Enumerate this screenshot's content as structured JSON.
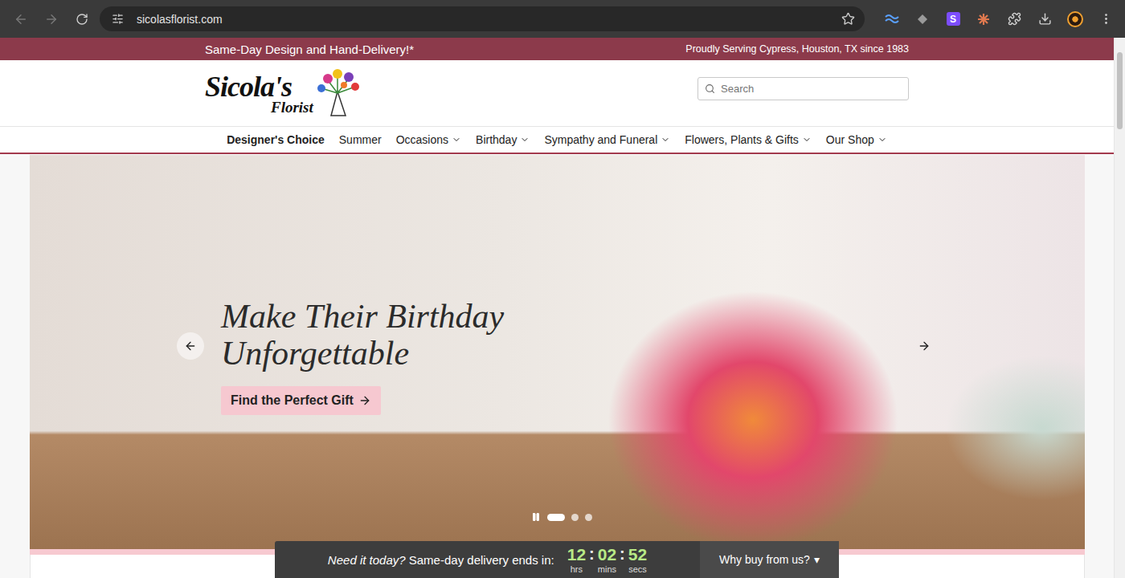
{
  "browser": {
    "url": "sicolasflorist.com",
    "extension_badge": "S"
  },
  "promo_bar": {
    "left": "Same-Day Design and Hand-Delivery!*",
    "right": "Proudly Serving Cypress, Houston, TX since 1983"
  },
  "logo": {
    "line1": "Sicola's",
    "line2": "Florist"
  },
  "search": {
    "placeholder": "Search"
  },
  "nav": [
    {
      "label": "Designer's Choice",
      "emphasized": true,
      "dropdown": false
    },
    {
      "label": "Summer",
      "emphasized": false,
      "dropdown": false
    },
    {
      "label": "Occasions",
      "emphasized": false,
      "dropdown": true
    },
    {
      "label": "Birthday",
      "emphasized": false,
      "dropdown": true
    },
    {
      "label": "Sympathy and Funeral",
      "emphasized": false,
      "dropdown": true
    },
    {
      "label": "Flowers, Plants & Gifts",
      "emphasized": false,
      "dropdown": true
    },
    {
      "label": "Our Shop",
      "emphasized": false,
      "dropdown": true
    }
  ],
  "hero": {
    "title_lines": [
      "Make Their Birthday",
      "Unforgettable"
    ],
    "button": "Find the Perfect Gift",
    "slides": [
      {
        "selected": true
      },
      {
        "selected": false
      },
      {
        "selected": false
      }
    ]
  },
  "countdown": {
    "prompt": "Need it today?",
    "label": "Same-day delivery ends in:",
    "separator": ":",
    "units": [
      {
        "value": "12",
        "unit": "hrs"
      },
      {
        "value": "02",
        "unit": "mins"
      },
      {
        "value": "52",
        "unit": "secs"
      }
    ],
    "button": "Why buy from us?",
    "caret": "▾"
  }
}
